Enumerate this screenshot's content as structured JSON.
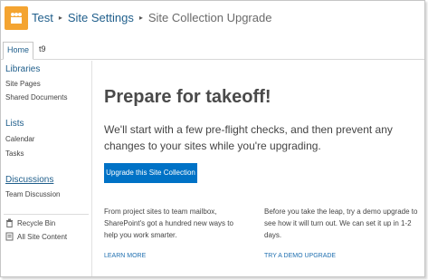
{
  "header": {
    "breadcrumb": [
      "Test",
      "Site Settings",
      "Site Collection Upgrade"
    ],
    "separator": "▸",
    "logo_icon": "sharepoint-site-icon",
    "logo_color": "#f4a431"
  },
  "topnav": {
    "tabs": [
      {
        "label": "Home",
        "selected": true
      },
      {
        "label": "t9",
        "selected": false
      }
    ]
  },
  "leftnav": {
    "sections": [
      {
        "heading": "Libraries",
        "items": [
          "Site Pages",
          "Shared Documents"
        ]
      },
      {
        "heading": "Lists",
        "items": [
          "Calendar",
          "Tasks"
        ]
      },
      {
        "heading": "Discussions",
        "items": [
          "Team Discussion"
        ]
      }
    ],
    "footer": [
      {
        "label": "Recycle Bin",
        "icon": "recycle-bin-icon"
      },
      {
        "label": "All Site Content",
        "icon": "site-contents-icon"
      }
    ]
  },
  "main": {
    "title": "Prepare for takeoff!",
    "description": "We'll start with a few pre-flight checks, and then prevent any changes to your sites while you're upgrading.",
    "cta_label": "Upgrade this Site Collection",
    "columns": [
      {
        "text": "From project sites to team mailbox, SharePoint's got a hundred new ways to help you work smarter.",
        "link": "LEARN MORE"
      },
      {
        "text": "Before you take the leap, try a demo upgrade to see how it will turn out. We can set it up in 1-2 days.",
        "link": "TRY A DEMO UPGRADE"
      }
    ]
  },
  "colors": {
    "accent": "#0072c6",
    "link": "#1f5e8b"
  }
}
